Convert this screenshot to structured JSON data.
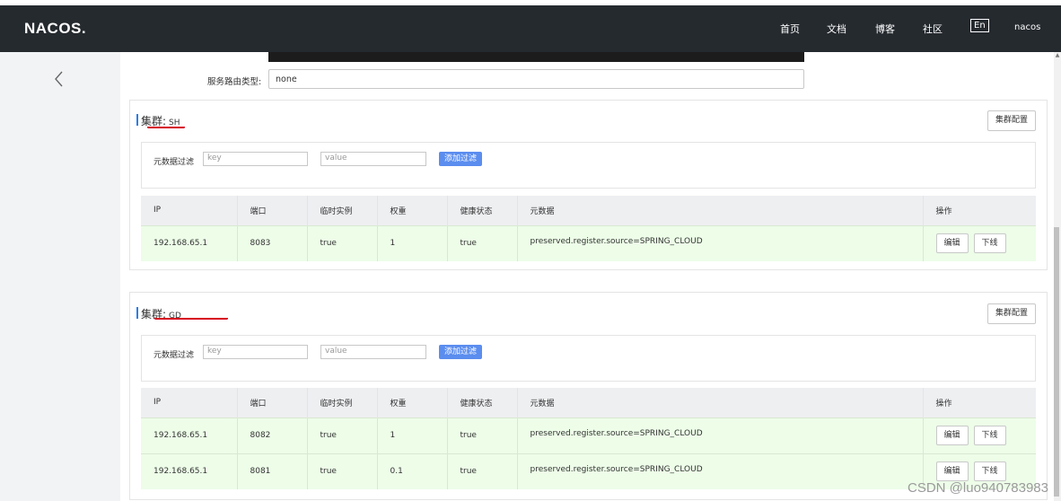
{
  "header": {
    "logo": "NACOS.",
    "nav": [
      "首页",
      "文档",
      "博客",
      "社区"
    ],
    "lang": "En",
    "user": "nacos"
  },
  "service": {
    "route_type_label": "服务路由类型:",
    "route_type_value": "none"
  },
  "clusters": [
    {
      "title": "集群:",
      "name": "SH",
      "config_button": "集群配置",
      "filter_label": "元数据过滤",
      "key_placeholder": "key",
      "value_placeholder": "value",
      "filter_button": "添加过滤",
      "columns": [
        "IP",
        "端口",
        "临时实例",
        "权重",
        "健康状态",
        "元数据",
        "操作"
      ],
      "rows": [
        {
          "ip": "192.168.65.1",
          "port": "8083",
          "ephemeral": "true",
          "weight": "1",
          "healthy": "true",
          "metadata": "preserved.register.source=SPRING_CLOUD",
          "edit": "编辑",
          "offline": "下线"
        }
      ]
    },
    {
      "title": "集群:",
      "name": "GD",
      "config_button": "集群配置",
      "filter_label": "元数据过滤",
      "key_placeholder": "key",
      "value_placeholder": "value",
      "filter_button": "添加过滤",
      "columns": [
        "IP",
        "端口",
        "临时实例",
        "权重",
        "健康状态",
        "元数据",
        "操作"
      ],
      "rows": [
        {
          "ip": "192.168.65.1",
          "port": "8082",
          "ephemeral": "true",
          "weight": "1",
          "healthy": "true",
          "metadata": "preserved.register.source=SPRING_CLOUD",
          "edit": "编辑",
          "offline": "下线"
        },
        {
          "ip": "192.168.65.1",
          "port": "8081",
          "ephemeral": "true",
          "weight": "0.1",
          "healthy": "true",
          "metadata": "preserved.register.source=SPRING_CLOUD",
          "edit": "编辑",
          "offline": "下线"
        }
      ]
    }
  ],
  "watermark": "CSDN @luo940783983",
  "colors": {
    "header_bg": "#252a2f",
    "row_bg": "#edfde8",
    "accent": "#5b8def",
    "annotation": "#d6001c"
  }
}
